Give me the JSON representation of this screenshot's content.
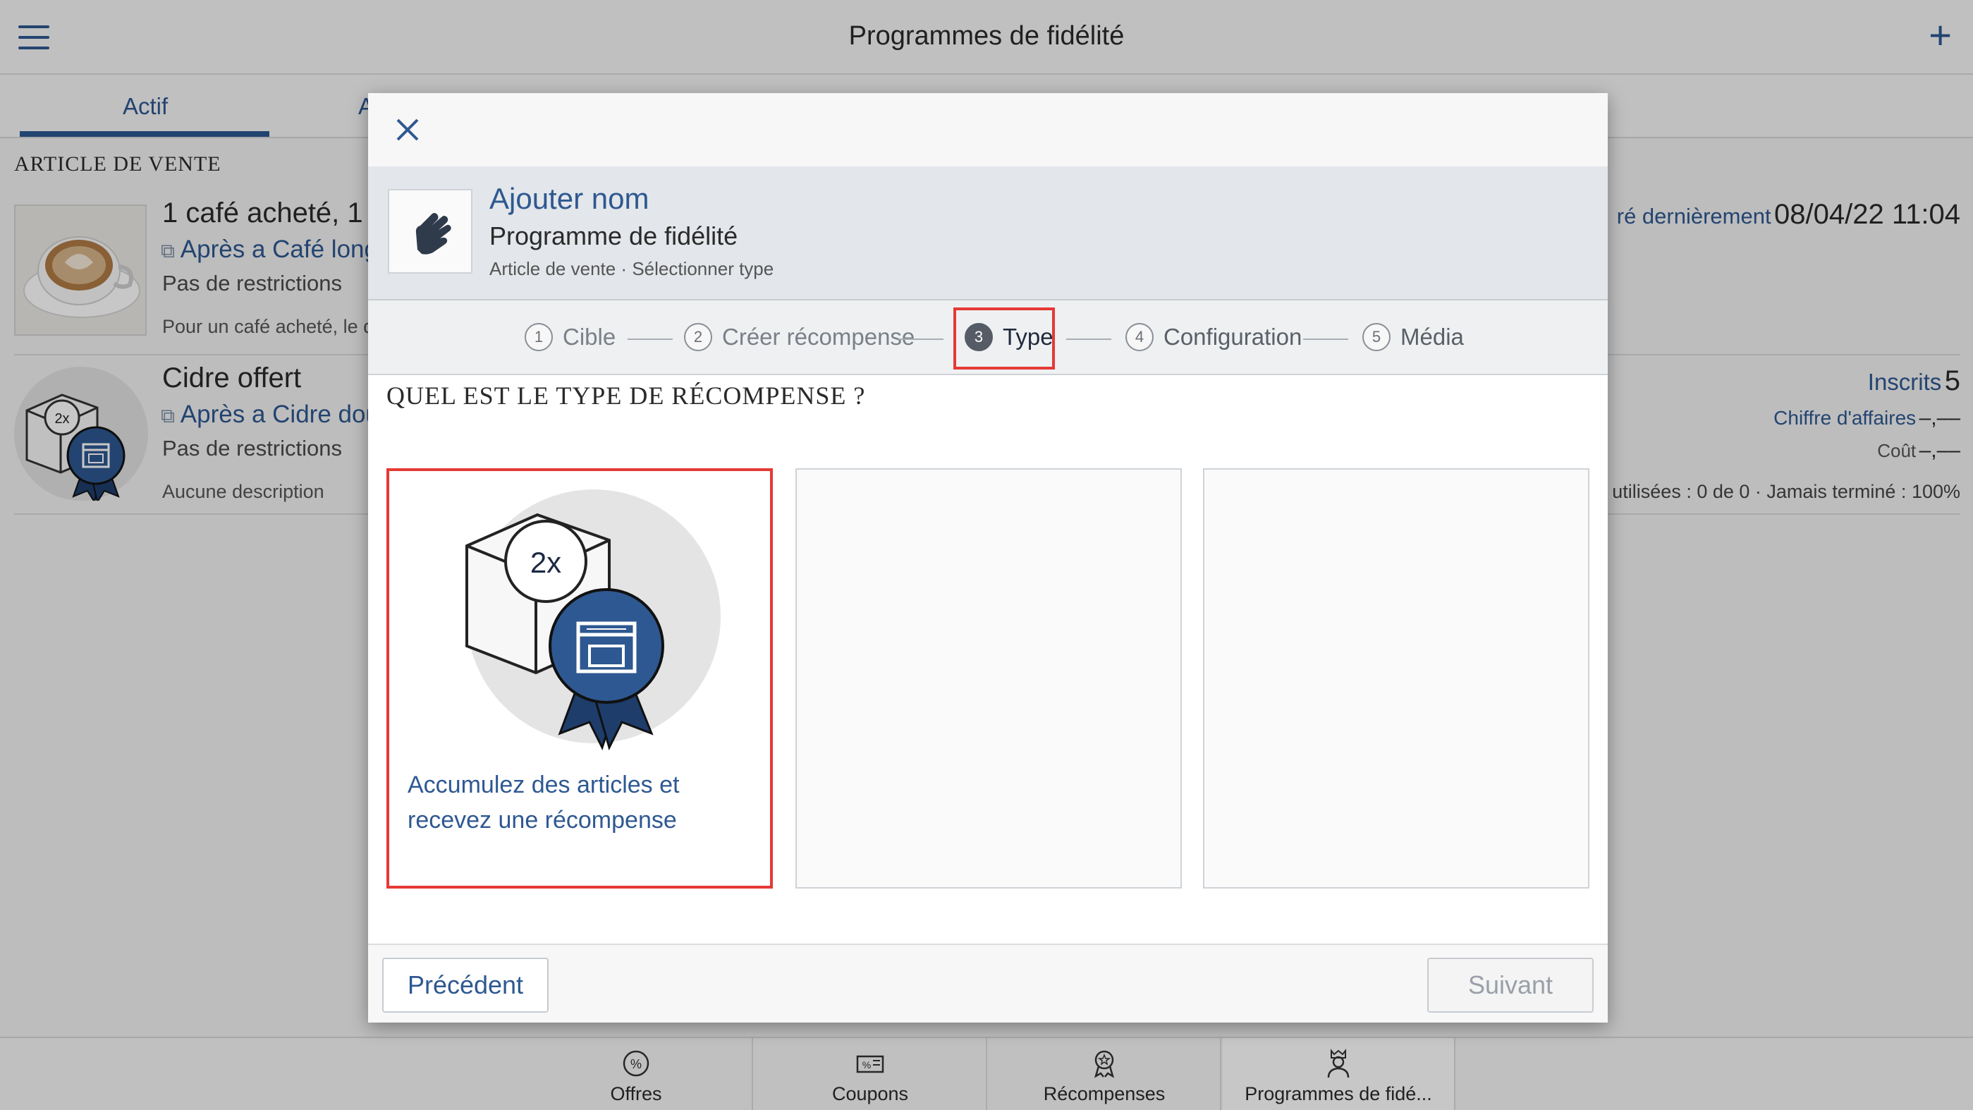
{
  "app": {
    "title": "Programmes de fidélité",
    "menu_icon": "hamburger-menu-icon",
    "add_icon": "plus-icon"
  },
  "tabs": [
    {
      "label": "Actif"
    },
    {
      "label": "A"
    }
  ],
  "list": {
    "section_label": "ARTICLE DE VENTE",
    "items": [
      {
        "title": "1 café acheté, 1 c",
        "item_line": "Après a Café long",
        "restrictions": "Pas de restrictions",
        "description": "Pour un café acheté, le de",
        "right_label": "ré dernièrement",
        "right_value": "08/04/22 11:04"
      },
      {
        "title": "Cidre offert",
        "item_line": "Après a Cidre dou",
        "restrictions": "Pas de restrictions",
        "description": "Aucune description",
        "enrolled_label": "Inscrits",
        "enrolled_value": "5",
        "revenue_label": "Chiffre d'affaires",
        "revenue_value": "–,––",
        "cost_label": "Coût",
        "cost_value": "–,––",
        "stats": "es utilisées : 0 de 0 · Jamais terminé :  100%"
      }
    ]
  },
  "bottom_nav": [
    {
      "label": "Offres",
      "icon": "percent-badge-icon"
    },
    {
      "label": "Coupons",
      "icon": "coupon-icon"
    },
    {
      "label": "Récompenses",
      "icon": "award-icon"
    },
    {
      "label": "Programmes de fidé...",
      "icon": "loyalty-program-icon"
    }
  ],
  "modal": {
    "close_icon": "close-icon",
    "program": {
      "name": "Ajouter nom",
      "type": "Programme de fidélité",
      "breadcrumb": "Article de vente · Sélectionner type",
      "icon": "hand-icon"
    },
    "steps": [
      {
        "num": "1",
        "label": "Cible"
      },
      {
        "num": "2",
        "label": "Créer récompense"
      },
      {
        "num": "3",
        "label": "Type"
      },
      {
        "num": "4",
        "label": "Configuration"
      },
      {
        "num": "5",
        "label": "Média"
      }
    ],
    "question": "QUEL EST LE TYPE DE RÉCOMPENSE ?",
    "cards": [
      {
        "text": "Accumulez des articles et recevez une récompense",
        "badge": "2x",
        "icon": "stamp-card-reward-icon"
      }
    ],
    "footer": {
      "prev_label": "Précédent",
      "next_label": "Suivant"
    }
  }
}
